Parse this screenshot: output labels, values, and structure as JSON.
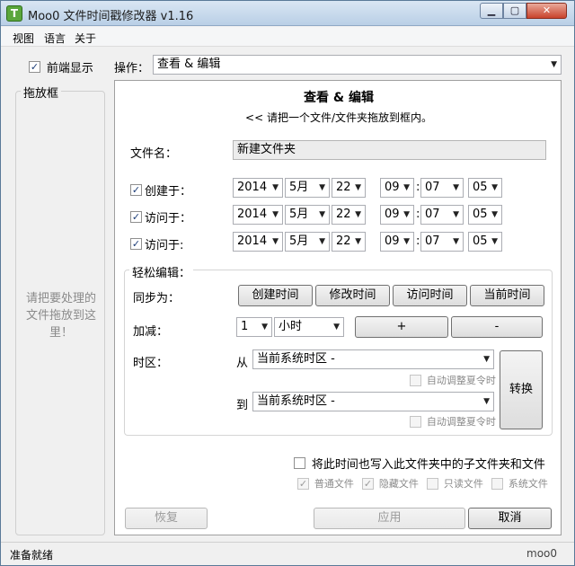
{
  "window": {
    "title": "Moo0 文件时间戳修改器 v1.16",
    "icon_letter": "T"
  },
  "menu": [
    "视图",
    "语言",
    "关于"
  ],
  "topbar": {
    "topmost_label": "前端显示",
    "operation_label": "操作：",
    "operation_value": "查看 & 编辑"
  },
  "dropbox": {
    "title": "拖放框",
    "hint": "请把要处理的文件拖放到这里！"
  },
  "panel": {
    "heading": "查看 & 编辑",
    "subheading": "<< 请把一个文件/文件夹拖放到框内。",
    "filename_label": "文件名：",
    "filename_value": "新建文件夹",
    "rows": [
      {
        "label": "创建于：",
        "year": "2014",
        "month": "5月",
        "day": "22",
        "hour": "09",
        "minute": "07",
        "second": "05"
      },
      {
        "label": "访问于：",
        "year": "2014",
        "month": "5月",
        "day": "22",
        "hour": "09",
        "minute": "07",
        "second": "05"
      },
      {
        "label": "访问于:",
        "year": "2014",
        "month": "5月",
        "day": "22",
        "hour": "09",
        "minute": "07",
        "second": "05"
      }
    ],
    "easy": {
      "title": "轻松编辑：",
      "sync_label": "同步为：",
      "sync_buttons": [
        "创建时间",
        "修改时间",
        "访问时间",
        "当前时间"
      ],
      "adjust_label": "加减：",
      "adjust_value": "1",
      "adjust_unit": "小时",
      "plus": "+",
      "minus": "-",
      "tz_label": "时区：",
      "from_label": "从",
      "from_value": "当前系统时区 -",
      "to_label": "到",
      "to_value": "当前系统时区 -",
      "dst_label": "自动调整夏令时",
      "convert": "转换"
    },
    "write_sub_label": "将此时间也写入此文件夹中的子文件夹和文件",
    "attrs": [
      "普通文件",
      "隐藏文件",
      "只读文件",
      "系统文件"
    ],
    "restore": "恢复",
    "apply": "应用",
    "cancel": "取消"
  },
  "status": {
    "text": "准备就绪",
    "brand": "moo0"
  }
}
